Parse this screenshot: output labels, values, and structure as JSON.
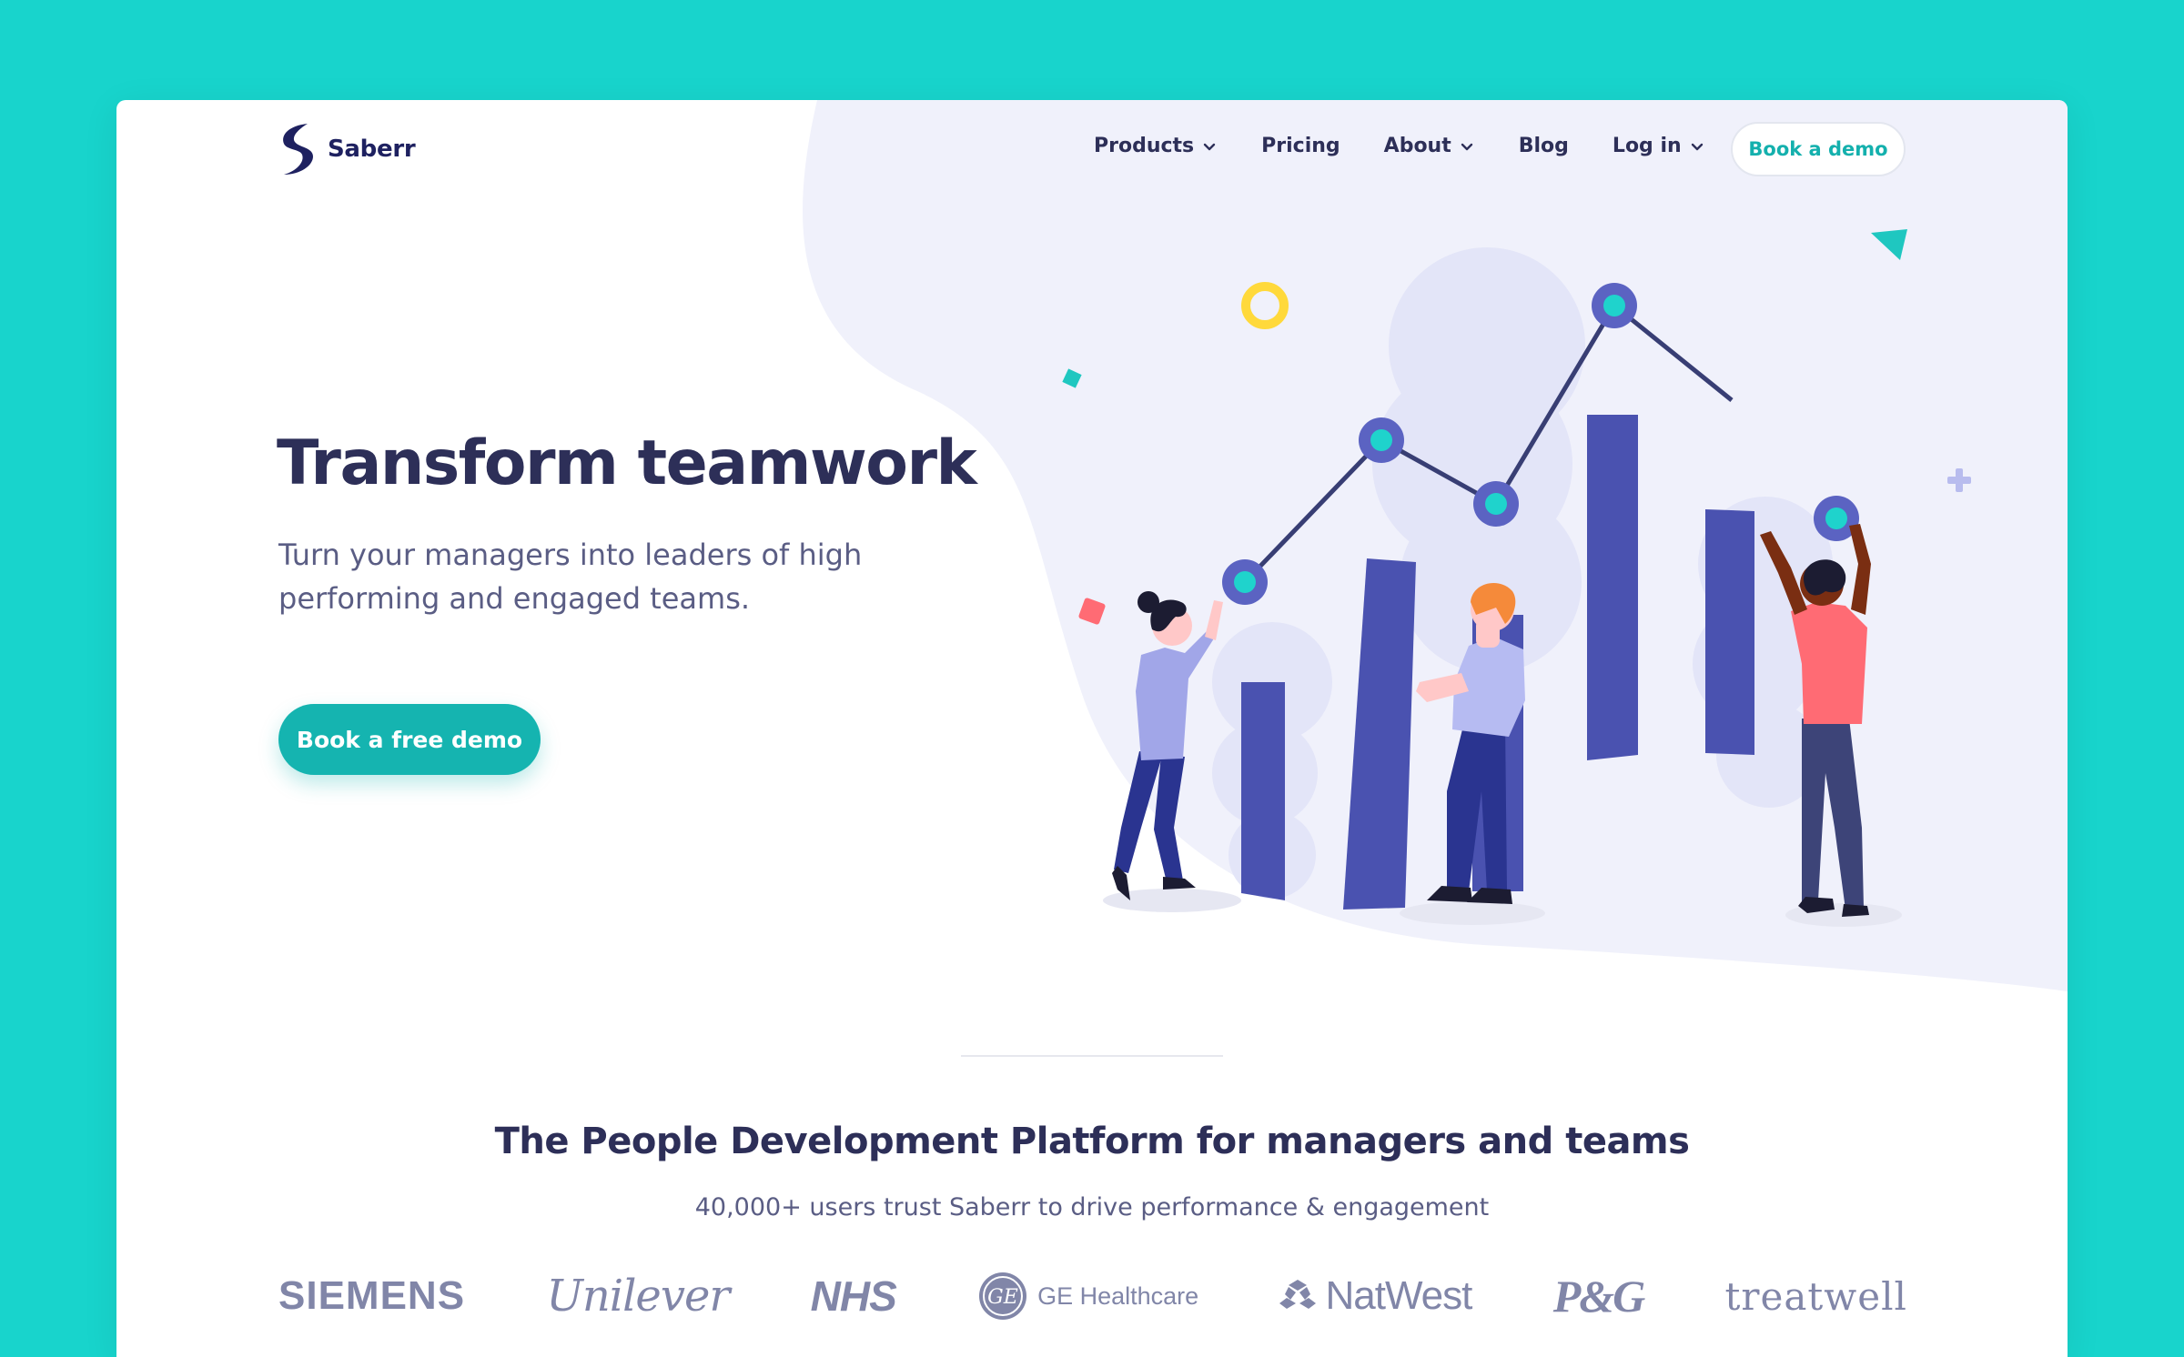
{
  "brand": {
    "name": "Saberr",
    "logo_icon": "saberr-s-logo-icon"
  },
  "nav": {
    "items": [
      {
        "label": "Products",
        "has_dropdown": true
      },
      {
        "label": "Pricing",
        "has_dropdown": false
      },
      {
        "label": "About",
        "has_dropdown": true
      },
      {
        "label": "Blog",
        "has_dropdown": false
      },
      {
        "label": "Log in",
        "has_dropdown": true
      }
    ],
    "cta_label": "Book a demo"
  },
  "hero": {
    "title": "Transform teamwork",
    "subtitle": "Turn your managers into leaders of high performing and engaged teams.",
    "cta_label": "Book a free demo"
  },
  "platform": {
    "title": "The People Development Platform for managers and teams",
    "subtitle": "40,000+ users trust Saberr to drive performance & engagement"
  },
  "client_logos": [
    "SIEMENS",
    "Unilever",
    "NHS",
    "GE Healthcare",
    "NatWest",
    "P&G",
    "treatwell"
  ],
  "colors": {
    "page_background": "#18d4cc",
    "primary_teal": "#15b4b0",
    "navy_text": "#2d2f58",
    "bar_indigo": "#4a52b0",
    "logo_gray": "#8186a8"
  }
}
